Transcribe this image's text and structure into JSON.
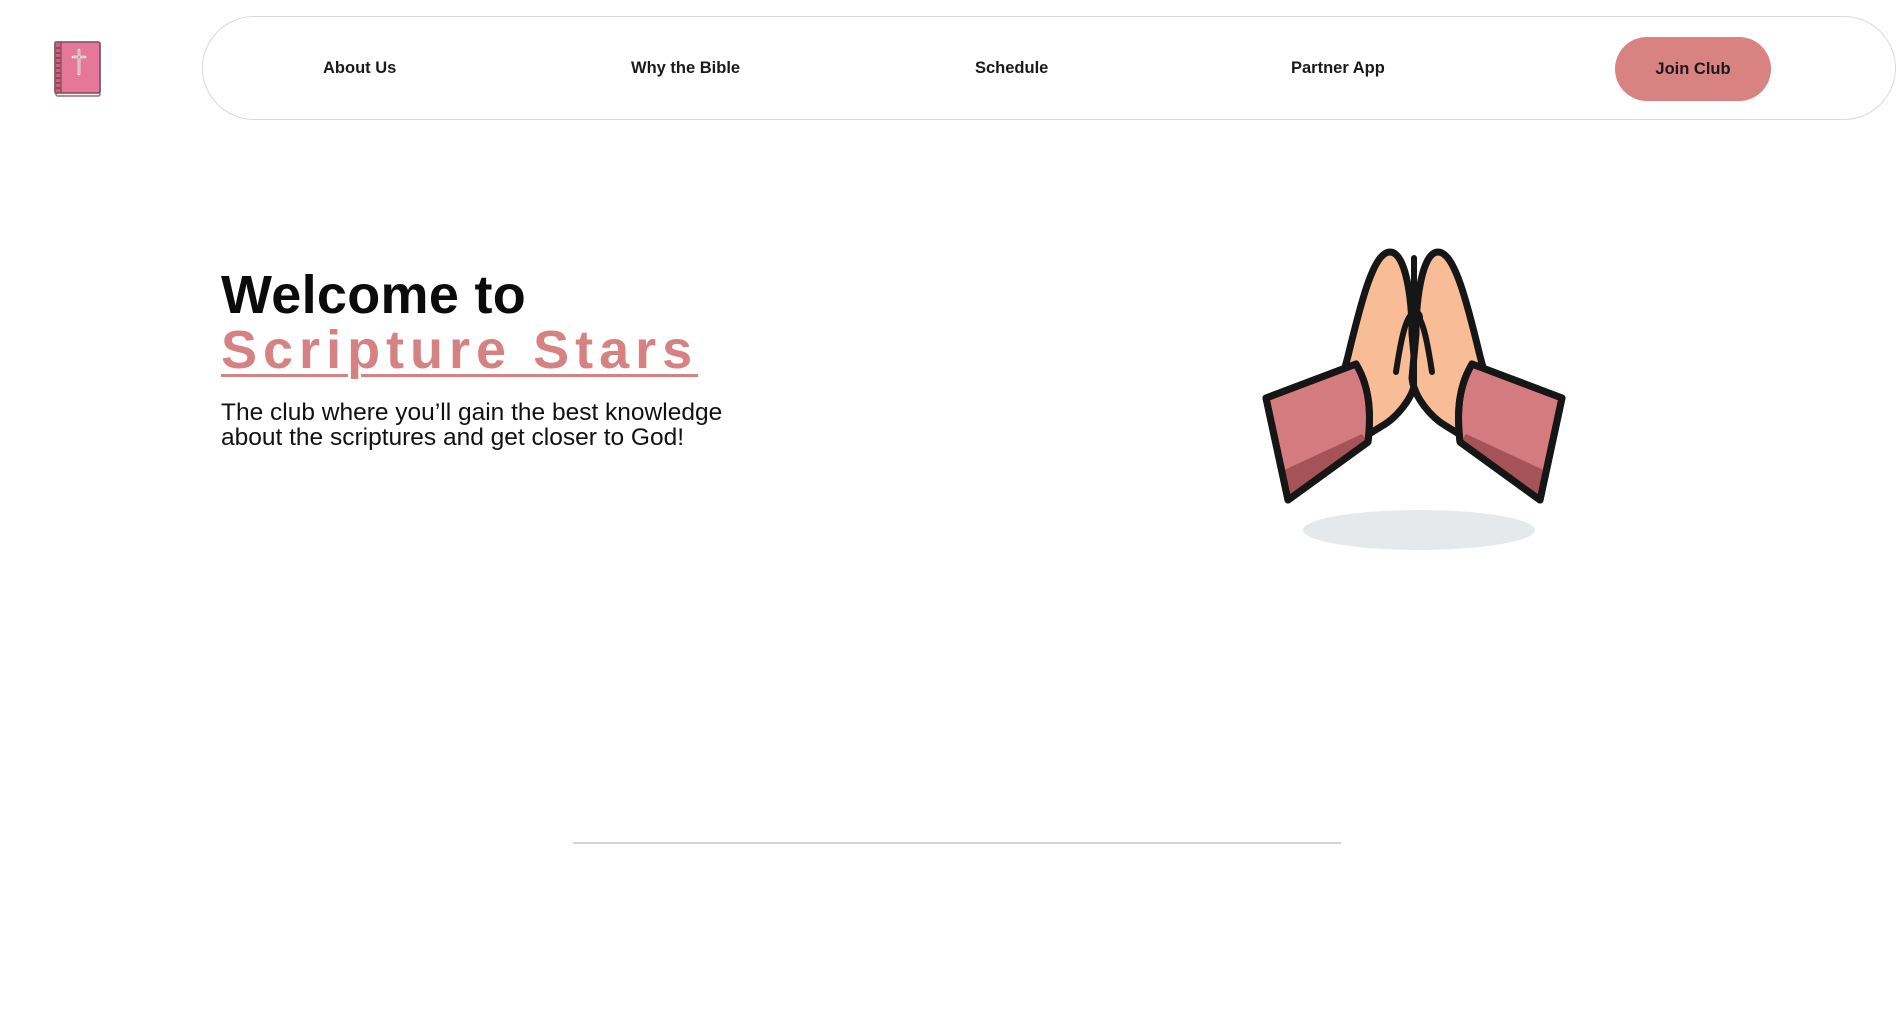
{
  "logo": {
    "icon": "bible-icon"
  },
  "nav": {
    "links": [
      "About Us",
      "Why the Bible",
      "Schedule",
      "Partner App"
    ],
    "cta": "Join Club"
  },
  "hero": {
    "title": "Welcome to",
    "brand": "Scripture Stars",
    "subtitle_line1": "The club where you’ll gain the best knowledge",
    "subtitle_line2": "about the scriptures and get closer to God!",
    "illustration": "praying-hands-icon"
  },
  "colors": {
    "accent": "#d88382",
    "text": "#111111",
    "border": "#d9d9d9",
    "background": "#ffffff"
  }
}
